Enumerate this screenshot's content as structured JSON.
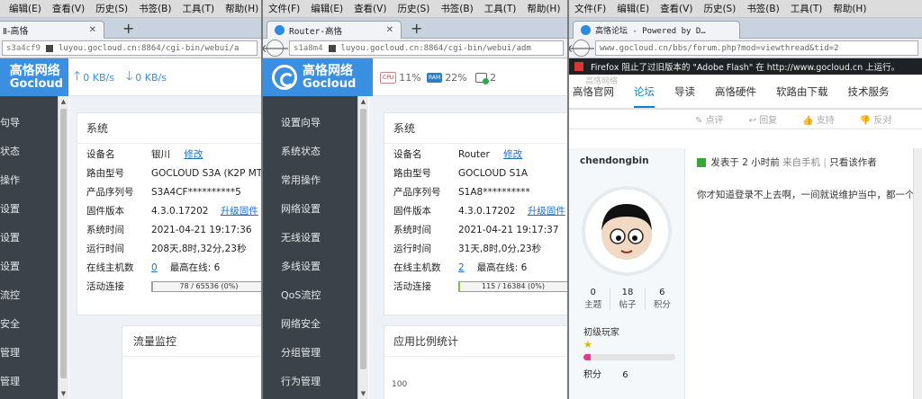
{
  "menu": [
    "文件(F)",
    "编辑(E)",
    "查看(V)",
    "历史(S)",
    "书签(B)",
    "工具(T)",
    "帮助(H)"
  ],
  "pane1": {
    "menu": [
      "编辑(E)",
      "查看(V)",
      "历史(S)",
      "书签(B)",
      "工具(T)",
      "帮助(H)"
    ],
    "tab_title": "Ⅱ-高恪",
    "url_prefix": "s3a4cf9",
    "url": "luyou.gocloud.cn:8864/cgi-bin/webui/a",
    "logo_cn": "高恪网络",
    "logo_en": "Gocloud",
    "upload": "0 KB/s",
    "download": "0 KB/s",
    "sidebar": [
      "句导",
      "状态",
      "操作",
      "设置",
      "设置",
      "设置",
      "流控",
      "安全",
      "管理",
      "管理"
    ],
    "card_title": "系统",
    "rows": [
      {
        "k": "设备名",
        "v": "银川",
        "link": "修改"
      },
      {
        "k": "路由型号",
        "v": "GOCLOUD S3A (K2P MTK"
      },
      {
        "k": "产品序列号",
        "v": "S3A4CF**********5"
      },
      {
        "k": "固件版本",
        "v": "4.3.0.17202",
        "link": "升级固件"
      },
      {
        "k": "系统时间",
        "v": "2021-04-21 19:17:36"
      },
      {
        "k": "运行时间",
        "v": "208天,8时,32分,23秒"
      },
      {
        "k": "在线主机数",
        "v": "0",
        "extra_label": "最高在线:",
        "extra_value": "6"
      },
      {
        "k": "活动连接",
        "bar": "78 / 65536 (0%)",
        "pct": 0.12
      }
    ],
    "card2_title": "流量监控"
  },
  "pane2": {
    "tab_title": "Router-高恪",
    "url_prefix": "s1a8m4",
    "url": "luyou.gocloud.cn:8864/cgi-bin/webui/adm",
    "logo_cn": "高恪网络",
    "logo_en": "Gocloud",
    "cpu_label": "CPU",
    "cpu": "11%",
    "ram_label": "RAM",
    "ram": "22%",
    "users": "2",
    "sidebar": [
      "设置向导",
      "系统状态",
      "常用操作",
      "网络设置",
      "无线设置",
      "多线设置",
      "QoS流控",
      "网络安全",
      "分组管理",
      "行为管理"
    ],
    "card_title": "系统",
    "rows": [
      {
        "k": "设备名",
        "v": "Router",
        "link": "修改"
      },
      {
        "k": "路由型号",
        "v": "GOCLOUD S1A"
      },
      {
        "k": "产品序列号",
        "v": "S1A8**********"
      },
      {
        "k": "固件版本",
        "v": "4.3.0.17202",
        "link": "升级固件"
      },
      {
        "k": "系统时间",
        "v": "2021-04-21 19:17:37"
      },
      {
        "k": "运行时间",
        "v": "31天,8时,0分,23秒"
      },
      {
        "k": "在线主机数",
        "v": "2",
        "extra_label": "最高在线:",
        "extra_value": "6"
      },
      {
        "k": "活动连接",
        "bar": "115 / 16384 (0%)",
        "pct": 0.7
      }
    ],
    "card2_title": "应用比例统计",
    "chart_tick": "100"
  },
  "pane3": {
    "tab_title": "高恪论坛 - Powered by D…",
    "url": "www.gocloud.cn/bbs/forum.php?mod=viewthread&tid=2",
    "flash_warning": "Firefox 阻止了过旧版本的 \"Adobe Flash\" 在 http://www.gocloud.cn 上运行。",
    "nav_ghost": "高恪网络",
    "nav": [
      "高恪官网",
      "论坛",
      "导读",
      "高恪硬件",
      "软路由下载",
      "技术服务"
    ],
    "actions": [
      "点评",
      "回复",
      "支持",
      "反对"
    ],
    "username": "chendongbin",
    "post_prefix": "发表于",
    "post_time": "2 小时前",
    "post_source": "来自手机",
    "post_sep": "|",
    "post_only_author": "只看该作者",
    "stats": [
      {
        "n": "0",
        "l": "主题"
      },
      {
        "n": "18",
        "l": "帖子"
      },
      {
        "n": "6",
        "l": "积分"
      }
    ],
    "rank": "初级玩家",
    "points_label": "积分",
    "points_value": "6",
    "points_fill": 0.08,
    "post_text": "你才知道登录不上去啊，一间就说维护当中，都一个"
  },
  "colors": {
    "router_blue": "#3b8fe0",
    "sidebar_dark": "#3c4249",
    "forum_blue": "#0a7fd1"
  }
}
